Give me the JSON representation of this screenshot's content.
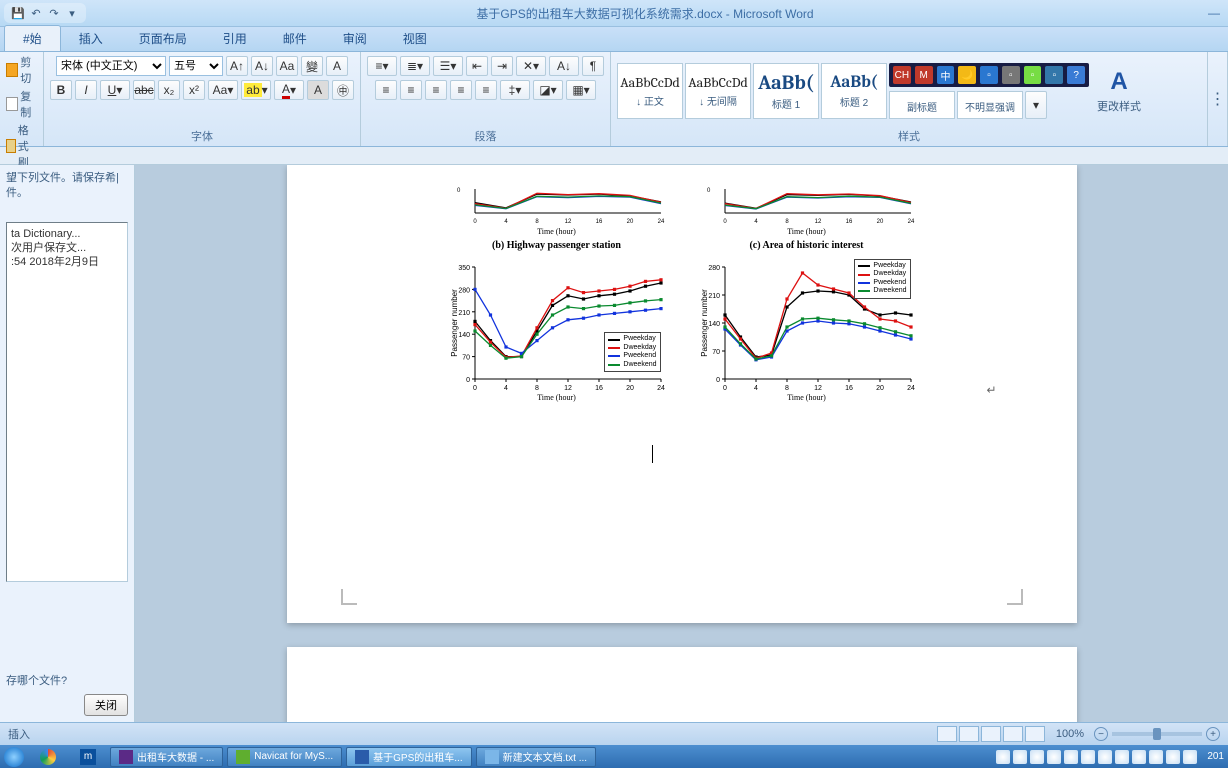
{
  "titlebar": {
    "title": "基于GPS的出租车大数据可视化系统需求.docx - Microsoft Word"
  },
  "tabs": {
    "home": "#始",
    "insert": "插入",
    "layout": "页面布局",
    "ref": "引用",
    "mail": "邮件",
    "review": "审阅",
    "view": "视图"
  },
  "clipboard": {
    "cut": "剪切",
    "copy": "复制",
    "painter": "格式刷"
  },
  "font": {
    "name": "宋体 (中文正文)",
    "size": "五号",
    "grow": "A",
    "shrink": "A",
    "clear": "Aa",
    "phon": "拼",
    "box": "A",
    "bold": "B",
    "italic": "I",
    "under": "U",
    "strike": "abc",
    "sub": "x₂",
    "sup": "x²",
    "case": "Aa",
    "hl": "ab",
    "color": "A",
    "border": "A",
    "shade": "A",
    "label": "字体"
  },
  "para": {
    "label": "段落"
  },
  "styles": {
    "s1": {
      "prev": "AaBbCcDd",
      "name": "↓ 正文"
    },
    "s2": {
      "prev": "AaBbCcDd",
      "name": "↓ 无间隔"
    },
    "s3": {
      "prev": "AaBb(",
      "name": "标题 1"
    },
    "s4": {
      "prev": "AaBb(",
      "name": "标题 2"
    },
    "s5": {
      "prev": "AaBbCcDd",
      "name": "副标题"
    },
    "s6": {
      "prev": "AaBbCcDd",
      "name": "不明显强调"
    },
    "label": "样式",
    "change": "更改样式"
  },
  "sidebar": {
    "msg": "望下列文件。请保存希|件。",
    "recent1": "ta Dictionary...",
    "recent2": "次用户保存文...",
    "recent3": ":54 2018年2月9日",
    "q": "存哪个文件?",
    "close": "关闭"
  },
  "doc": {
    "title_b": "(b) Highway passenger station",
    "title_c": "(c) Area of historic interest",
    "xlabel": "Time (hour)",
    "ylabel": "Passenger number",
    "legend": [
      "Pweekday",
      "Dweekday",
      "Pweekend",
      "Dweekend"
    ]
  },
  "chart_data": [
    {
      "type": "line",
      "name": "mini_b_top",
      "x": [
        0,
        4,
        8,
        12,
        16,
        20,
        24
      ],
      "series": [
        {
          "name": "Pweekday",
          "color": "#000",
          "values": [
            120,
            60,
            220,
            210,
            220,
            200,
            130
          ]
        },
        {
          "name": "Dweekday",
          "color": "#d11",
          "values": [
            110,
            55,
            230,
            215,
            225,
            205,
            125
          ]
        },
        {
          "name": "Pweekend",
          "color": "#13d",
          "values": [
            90,
            50,
            190,
            180,
            195,
            185,
            110
          ]
        },
        {
          "name": "Dweekend",
          "color": "#0a8a2f",
          "values": [
            95,
            52,
            195,
            185,
            200,
            190,
            115
          ]
        }
      ],
      "xlabel": "Time (hour)",
      "ylabel": "Passenger number",
      "ylim": [
        0,
        280
      ]
    },
    {
      "type": "line",
      "name": "mini_c_top",
      "x": [
        0,
        4,
        8,
        12,
        16,
        20,
        24
      ],
      "series": [
        {
          "name": "Pweekday",
          "color": "#000",
          "values": [
            115,
            55,
            215,
            205,
            218,
            198,
            128
          ]
        },
        {
          "name": "Dweekday",
          "color": "#d11",
          "values": [
            108,
            52,
            225,
            212,
            222,
            202,
            122
          ]
        },
        {
          "name": "Pweekend",
          "color": "#13d",
          "values": [
            88,
            48,
            185,
            175,
            190,
            182,
            108
          ]
        },
        {
          "name": "Dweekend",
          "color": "#0a8a2f",
          "values": [
            92,
            50,
            190,
            180,
            196,
            186,
            112
          ]
        }
      ],
      "xlabel": "Time (hour)",
      "ylabel": "Passenger number",
      "ylim": [
        0,
        280
      ]
    },
    {
      "type": "line",
      "name": "b_bottom",
      "title": "(b) Highway passenger station",
      "x": [
        0,
        2,
        4,
        6,
        8,
        10,
        12,
        14,
        16,
        18,
        20,
        22,
        24
      ],
      "yticks": [
        0,
        70,
        140,
        210,
        280,
        350
      ],
      "series": [
        {
          "name": "Pweekday",
          "color": "#000",
          "marker": "sq",
          "values": [
            180,
            120,
            70,
            70,
            150,
            230,
            260,
            250,
            260,
            265,
            275,
            290,
            300
          ]
        },
        {
          "name": "Dweekday",
          "color": "#d11",
          "marker": "ci",
          "values": [
            170,
            115,
            68,
            72,
            160,
            245,
            285,
            270,
            275,
            280,
            290,
            305,
            310
          ]
        },
        {
          "name": "Pweekend",
          "color": "#13d",
          "marker": "di",
          "values": [
            280,
            200,
            100,
            80,
            120,
            160,
            185,
            190,
            200,
            205,
            210,
            215,
            220
          ]
        },
        {
          "name": "Dweekend",
          "color": "#0a8a2f",
          "marker": "tr",
          "values": [
            150,
            105,
            65,
            70,
            140,
            200,
            225,
            220,
            228,
            230,
            238,
            244,
            248
          ]
        }
      ],
      "xlabel": "Time (hour)",
      "ylabel": "Passenger number",
      "xlim": [
        0,
        24
      ],
      "ylim": [
        0,
        350
      ]
    },
    {
      "type": "line",
      "name": "c_bottom",
      "title": "(c) Area of historic interest",
      "x": [
        0,
        2,
        4,
        6,
        8,
        10,
        12,
        14,
        16,
        18,
        20,
        22,
        24
      ],
      "yticks": [
        0,
        70,
        140,
        210,
        280
      ],
      "series": [
        {
          "name": "Pweekday",
          "color": "#000",
          "marker": "sq",
          "values": [
            160,
            105,
            55,
            60,
            180,
            215,
            220,
            218,
            210,
            175,
            160,
            165,
            160
          ]
        },
        {
          "name": "Dweekday",
          "color": "#d11",
          "marker": "ci",
          "values": [
            150,
            100,
            52,
            65,
            200,
            265,
            235,
            225,
            215,
            180,
            150,
            145,
            130
          ]
        },
        {
          "name": "Pweekend",
          "color": "#13d",
          "marker": "di",
          "values": [
            125,
            85,
            48,
            55,
            120,
            140,
            145,
            140,
            138,
            130,
            120,
            110,
            100
          ]
        },
        {
          "name": "Dweekend",
          "color": "#0a8a2f",
          "marker": "tr",
          "values": [
            130,
            88,
            50,
            58,
            130,
            150,
            152,
            148,
            145,
            138,
            128,
            118,
            108
          ]
        }
      ],
      "xlabel": "Time (hour)",
      "ylabel": "Passenger number",
      "xlim": [
        0,
        24
      ],
      "ylim": [
        0,
        280
      ]
    }
  ],
  "status": {
    "mode": "插入",
    "zoom": "100%"
  },
  "taskbar": {
    "t1": "出租车大数据 - ...",
    "t2": "Navicat for MyS...",
    "t3": "基于GPS的出租车...",
    "t4": "新建文本文档.txt ...",
    "time": "201"
  }
}
